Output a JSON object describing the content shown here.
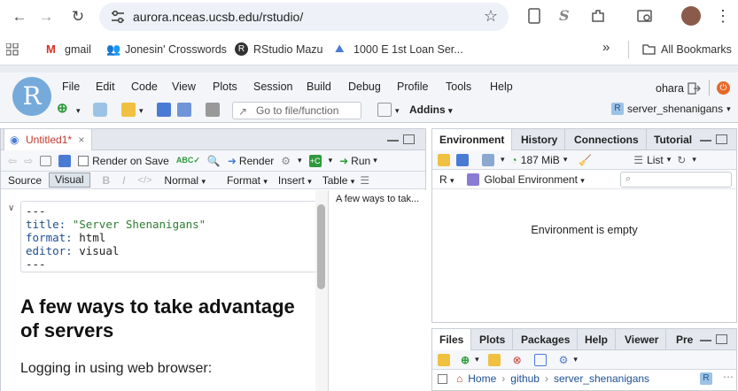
{
  "browser": {
    "url": "aurora.nceas.ucsb.edu/rstudio/",
    "bookmarks": [
      {
        "label": "gmail"
      },
      {
        "label": "Jonesin' Crosswords"
      },
      {
        "label": "RStudio Mazu"
      },
      {
        "label": "1000 E 1st Loan Ser..."
      }
    ],
    "all_bookmarks": "All Bookmarks",
    "more": "»"
  },
  "rstudio": {
    "logo": "R",
    "menus": [
      "File",
      "Edit",
      "Code",
      "View",
      "Plots",
      "Session",
      "Build",
      "Debug",
      "Profile",
      "Tools",
      "Help"
    ],
    "user": "ohara",
    "goto_placeholder": "Go to file/function",
    "addins": "Addins",
    "project": "server_shenanigans"
  },
  "editor": {
    "tab_title": "Untitled1*",
    "render_on_save": "Render on Save",
    "render": "Render",
    "run": "Run",
    "source": "Source",
    "visual": "Visual",
    "format_normal": "Normal",
    "format": "Format",
    "insert": "Insert",
    "table": "Table",
    "yaml": {
      "open": "---",
      "title_key": "title:",
      "title_val": "\"Server Shenanigans\"",
      "format_key": "format:",
      "format_val": "html",
      "editor_key": "editor:",
      "editor_val": "visual",
      "close": "---"
    },
    "heading": "A few ways to take advantage of servers",
    "paragraph": "Logging in using web browser:",
    "outline_item": "A few ways to tak..."
  },
  "environment": {
    "tabs": [
      "Environment",
      "History",
      "Connections",
      "Tutorial"
    ],
    "memory": "187 MiB",
    "list": "List",
    "lang": "R",
    "scope": "Global Environment",
    "empty_message": "Environment is empty"
  },
  "files": {
    "tabs": [
      "Files",
      "Plots",
      "Packages",
      "Help",
      "Viewer",
      "Pre"
    ],
    "breadcrumb": [
      "Home",
      "github",
      "server_shenanigans"
    ]
  }
}
